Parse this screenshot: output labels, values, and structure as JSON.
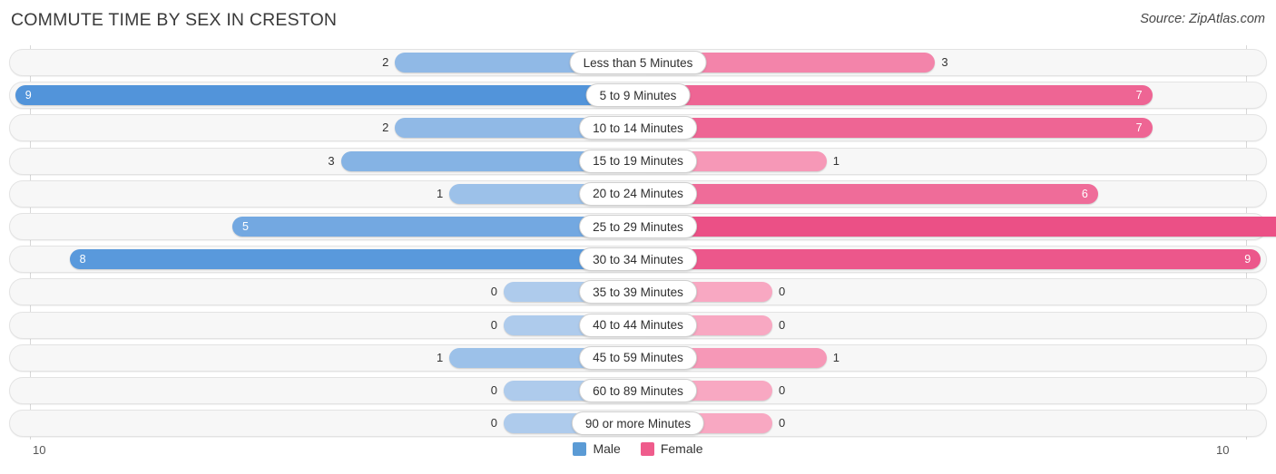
{
  "header": {
    "title": "COMMUTE TIME BY SEX IN CRESTON",
    "source": "Source: ZipAtlas.com"
  },
  "legend": {
    "items": [
      {
        "label": "Male",
        "color": "#5B9BD5"
      },
      {
        "label": "Female",
        "color": "#EF5C8C"
      }
    ]
  },
  "axis": {
    "left_label": "10",
    "right_label": "10",
    "max": 10
  },
  "chart_data": {
    "type": "bar",
    "subtype": "diverging-bar",
    "title": "COMMUTE TIME BY SEX IN CRESTON",
    "xlabel": "",
    "ylabel": "",
    "xlim": [
      10,
      10
    ],
    "grid": true,
    "legend_position": "bottom-center",
    "categories": [
      "Less than 5 Minutes",
      "5 to 9 Minutes",
      "10 to 14 Minutes",
      "15 to 19 Minutes",
      "20 to 24 Minutes",
      "25 to 29 Minutes",
      "30 to 34 Minutes",
      "35 to 39 Minutes",
      "40 to 44 Minutes",
      "45 to 59 Minutes",
      "60 to 89 Minutes",
      "90 or more Minutes"
    ],
    "series": [
      {
        "name": "Male",
        "direction": "left",
        "color": "#5B9BD5",
        "values": [
          2,
          9,
          2,
          3,
          1,
          5,
          8,
          0,
          0,
          1,
          0,
          0
        ]
      },
      {
        "name": "Female",
        "direction": "right",
        "color": "#EF5C8C",
        "values": [
          3,
          7,
          7,
          1,
          6,
          10,
          9,
          0,
          0,
          1,
          0,
          0
        ]
      }
    ]
  },
  "rows": [
    {
      "label": "Less than 5 Minutes",
      "male": "2",
      "female": "3"
    },
    {
      "label": "5 to 9 Minutes",
      "male": "9",
      "female": "7"
    },
    {
      "label": "10 to 14 Minutes",
      "male": "2",
      "female": "7"
    },
    {
      "label": "15 to 19 Minutes",
      "male": "3",
      "female": "1"
    },
    {
      "label": "20 to 24 Minutes",
      "male": "1",
      "female": "6"
    },
    {
      "label": "25 to 29 Minutes",
      "male": "5",
      "female": "10"
    },
    {
      "label": "30 to 34 Minutes",
      "male": "8",
      "female": "9"
    },
    {
      "label": "35 to 39 Minutes",
      "male": "0",
      "female": "0"
    },
    {
      "label": "40 to 44 Minutes",
      "male": "0",
      "female": "0"
    },
    {
      "label": "45 to 59 Minutes",
      "male": "1",
      "female": "1"
    },
    {
      "label": "60 to 89 Minutes",
      "male": "0",
      "female": "0"
    },
    {
      "label": "90 or more Minutes",
      "male": "0",
      "female": "0"
    }
  ]
}
